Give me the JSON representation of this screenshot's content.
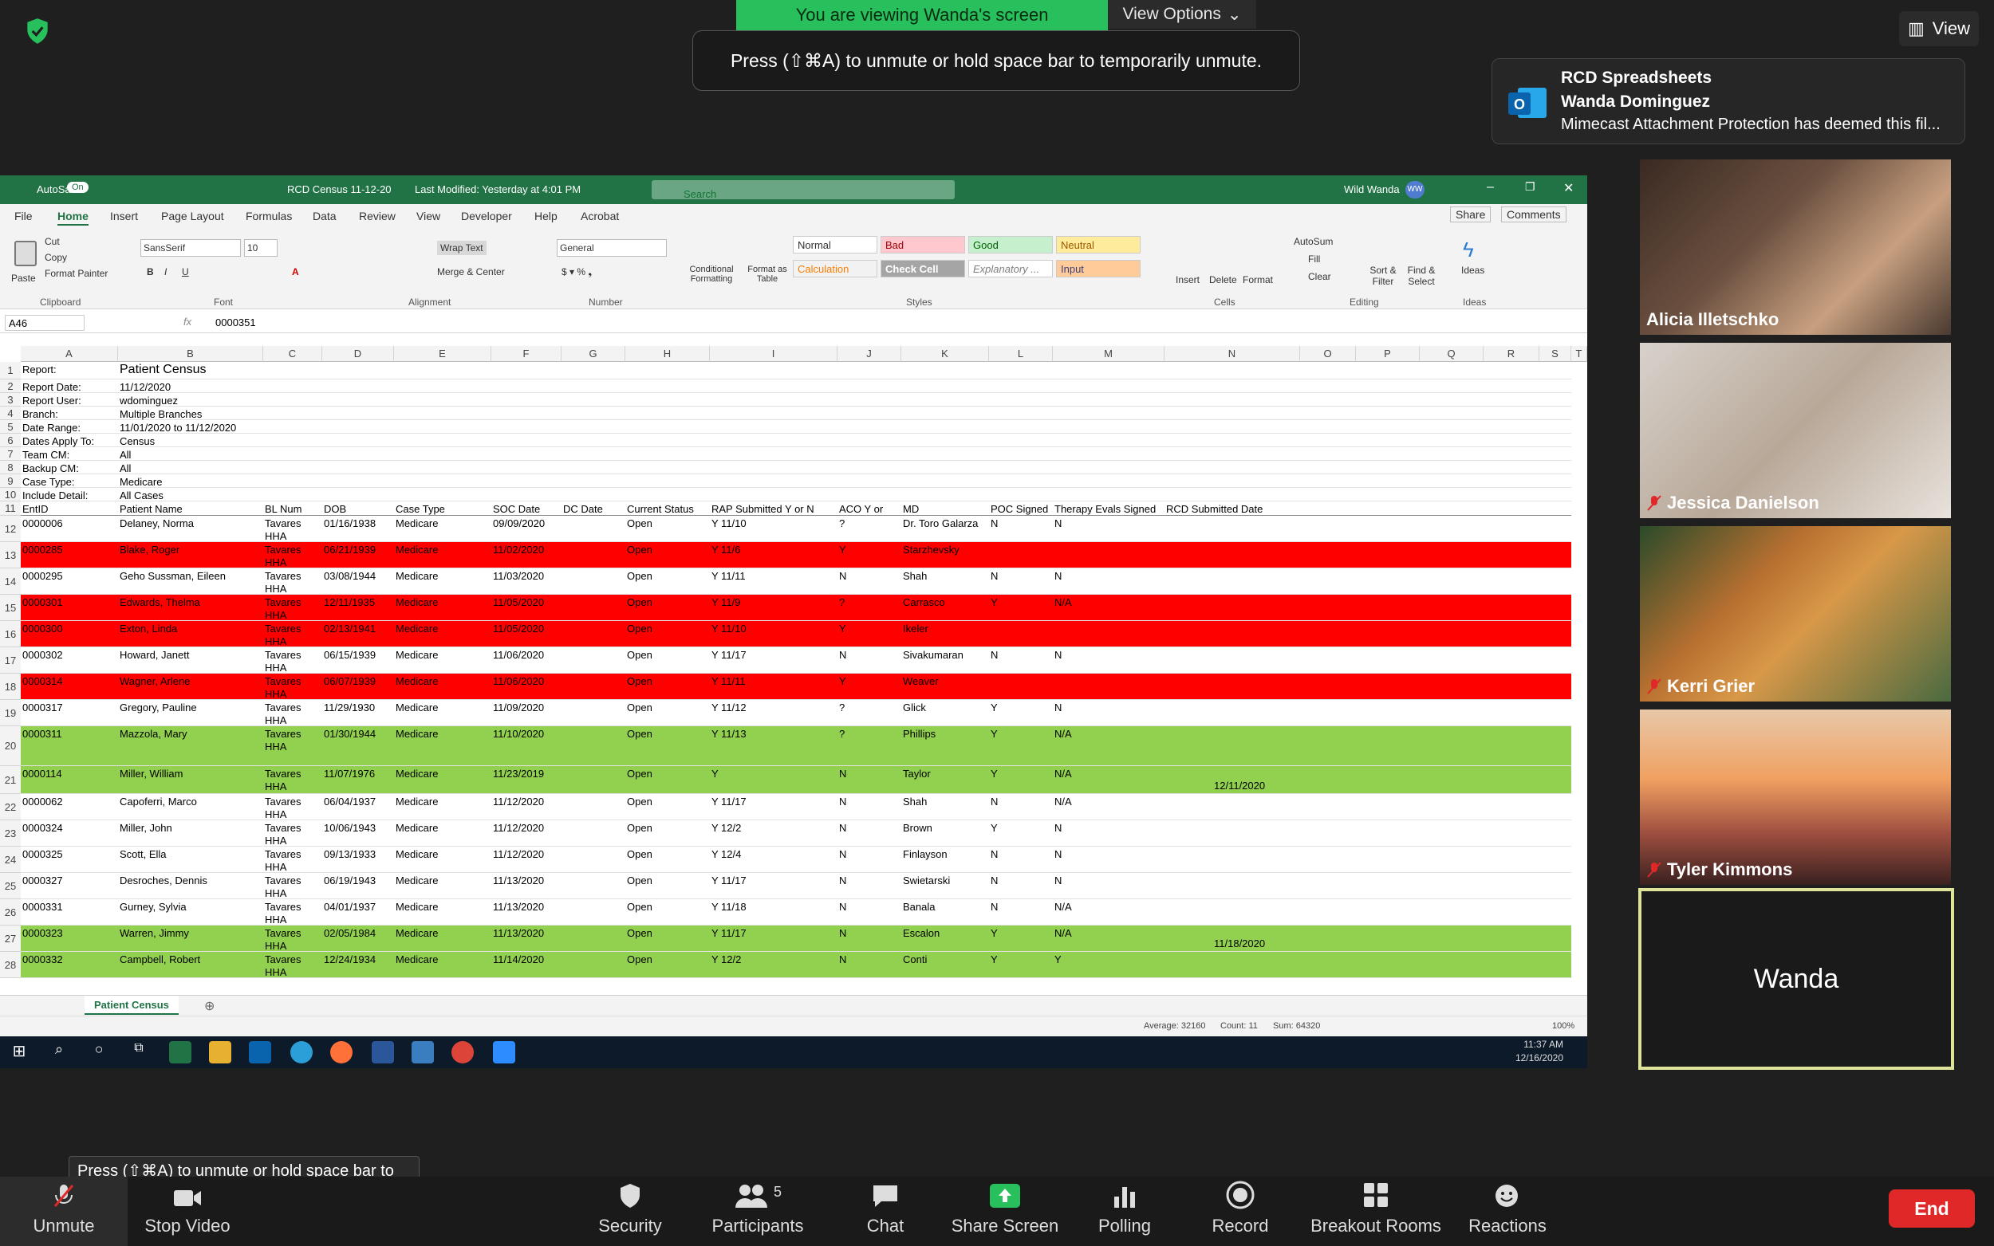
{
  "zoom": {
    "viewing_banner": "You are viewing Wanda's screen",
    "view_options": "View Options",
    "unmute_tip": "Press  (⇧⌘A) to unmute or hold space bar to temporarily unmute.",
    "view_button": "View",
    "tooltip": "Press  (⇧⌘A) to unmute or hold space bar to temporarily unmute.",
    "participant_count": "5",
    "bottom_bar": [
      "Unmute",
      "Stop Video",
      "Security",
      "Participants",
      "Chat",
      "Share Screen",
      "Polling",
      "Record",
      "Breakout Rooms",
      "Reactions"
    ],
    "end_label": "End",
    "share_color": "#27c05c",
    "end_color": "#e02828"
  },
  "notification": {
    "app": "RCD Spreadsheets",
    "sender": "Wanda Dominguez",
    "message": "Mimecast Attachment Protection has deemed this fil..."
  },
  "participants": [
    {
      "name": "Alicia Illetschko",
      "muted": false
    },
    {
      "name": "Jessica Danielson",
      "muted": true
    },
    {
      "name": "Kerri Grier",
      "muted": true
    },
    {
      "name": "Tyler Kimmons",
      "muted": true
    },
    {
      "name": "Wanda",
      "muted": false
    }
  ],
  "excel": {
    "autosave": "AutoSave",
    "autosave_state": "On",
    "file_title": "RCD Census 11-12-20",
    "last_modified": "Last Modified: Yesterday at 4:01 PM",
    "search_placeholder": "Search",
    "user": "Wild Wanda",
    "user_initials": "WW",
    "tabs": [
      "File",
      "Home",
      "Insert",
      "Page Layout",
      "Formulas",
      "Data",
      "Review",
      "View",
      "Developer",
      "Help",
      "Acrobat"
    ],
    "share": "Share",
    "comments": "Comments",
    "ribbon": {
      "paste": "Paste",
      "cut": "Cut",
      "copy": "Copy",
      "format_painter": "Format Painter",
      "clipboard": "Clipboard",
      "font_name": "SansSerif",
      "font_size": "10",
      "font": "Font",
      "wrap_text": "Wrap Text",
      "merge_center": "Merge & Center",
      "alignment": "Alignment",
      "number_format": "General",
      "number": "Number",
      "conditional": "Conditional Formatting",
      "format_table": "Format as Table",
      "styles": "Styles",
      "style_cells": [
        "Normal",
        "Bad",
        "Good",
        "Neutral",
        "Calculation",
        "Check Cell",
        "Explanatory ...",
        "Input"
      ],
      "insert": "Insert",
      "delete": "Delete",
      "format": "Format",
      "cells": "Cells",
      "autosum": "AutoSum",
      "fill": "Fill",
      "clear": "Clear",
      "sort_filter": "Sort & Filter",
      "find_select": "Find & Select",
      "editing": "Editing",
      "ideas": "Ideas",
      "ideas_group": "Ideas"
    },
    "name_box": "A46",
    "formula_value": "0000351",
    "columns": [
      "A",
      "B",
      "C",
      "D",
      "E",
      "F",
      "G",
      "H",
      "I",
      "J",
      "K",
      "L",
      "M",
      "N",
      "O",
      "P",
      "Q",
      "R",
      "S",
      "T"
    ],
    "meta_rows": [
      {
        "n": "1",
        "label": "Report:",
        "value": "Patient Census"
      },
      {
        "n": "2",
        "label": "Report Date:",
        "value": "11/12/2020"
      },
      {
        "n": "3",
        "label": "Report User:",
        "value": "wdominguez"
      },
      {
        "n": "4",
        "label": "Branch:",
        "value": "Multiple Branches"
      },
      {
        "n": "5",
        "label": "Date Range:",
        "value": "11/01/2020 to 11/12/2020"
      },
      {
        "n": "6",
        "label": "Dates Apply To:",
        "value": "Census"
      },
      {
        "n": "7",
        "label": "Team CM:",
        "value": "All"
      },
      {
        "n": "8",
        "label": "Backup CM:",
        "value": "All"
      },
      {
        "n": "9",
        "label": "Case Type:",
        "value": "Medicare"
      },
      {
        "n": "10",
        "label": "Include Detail:",
        "value": "All Cases"
      }
    ],
    "header_row": [
      "EntID",
      "Patient Name",
      "BL Num",
      "DOB",
      "Case Type",
      "SOC Date",
      "DC Date",
      "Current Status",
      "RAP Submitted Y or N",
      "ACO Y or",
      "MD",
      "POC Signed",
      "Therapy Evals Signed",
      "RCD Submitted Date"
    ],
    "data_rows": [
      {
        "n": "12",
        "fill": "",
        "cells": [
          "0000006",
          "Delaney, Norma",
          "Tavares HHA",
          "01/16/1938",
          "Medicare",
          "09/09/2020",
          "",
          "Open",
          "Y 11/10",
          "?",
          "Dr. Toro Galarza",
          "N",
          "N",
          ""
        ]
      },
      {
        "n": "13",
        "fill": "red",
        "cells": [
          "0000285",
          "Blake, Roger",
          "Tavares HHA",
          "06/21/1939",
          "Medicare",
          "11/02/2020",
          "",
          "Open",
          "Y 11/6",
          "Y",
          "Starzhevsky",
          "",
          "",
          ""
        ]
      },
      {
        "n": "14",
        "fill": "",
        "cells": [
          "0000295",
          "Geho Sussman, Eileen",
          "Tavares HHA",
          "03/08/1944",
          "Medicare",
          "11/03/2020",
          "",
          "Open",
          "Y 11/11",
          "N",
          "Shah",
          "N",
          "N",
          ""
        ]
      },
      {
        "n": "15",
        "fill": "red",
        "cells": [
          "0000301",
          "Edwards, Thelma",
          "Tavares HHA",
          "12/11/1935",
          "Medicare",
          "11/05/2020",
          "",
          "Open",
          "Y 11/9",
          "?",
          "Carrasco",
          "Y",
          "N/A",
          ""
        ]
      },
      {
        "n": "16",
        "fill": "red",
        "cells": [
          "0000300",
          "Exton, Linda",
          "Tavares HHA",
          "02/13/1941",
          "Medicare",
          "11/05/2020",
          "",
          "Open",
          "Y 11/10",
          "Y",
          "Ikeler",
          "",
          "",
          ""
        ]
      },
      {
        "n": "17",
        "fill": "",
        "cells": [
          "0000302",
          "Howard, Janett",
          "Tavares HHA",
          "06/15/1939",
          "Medicare",
          "11/06/2020",
          "",
          "Open",
          "Y 11/17",
          "N",
          "Sivakumaran",
          "N",
          "N",
          ""
        ]
      },
      {
        "n": "18",
        "fill": "red",
        "cells": [
          "0000314",
          "Wagner, Arlene",
          "Tavares HHA",
          "06/07/1939",
          "Medicare",
          "11/06/2020",
          "",
          "Open",
          "Y 11/11",
          "Y",
          "Weaver",
          "",
          "",
          ""
        ]
      },
      {
        "n": "19",
        "fill": "",
        "cells": [
          "0000317",
          "Gregory, Pauline",
          "Tavares HHA",
          "11/29/1930",
          "Medicare",
          "11/09/2020",
          "",
          "Open",
          "Y 11/12",
          "?",
          "Glick",
          "Y",
          "N",
          ""
        ]
      },
      {
        "n": "20",
        "fill": "green",
        "cells": [
          "0000311",
          "Mazzola, Mary",
          "Tavares HHA",
          "01/30/1944",
          "Medicare",
          "11/10/2020",
          "",
          "Open",
          "Y 11/13",
          "?",
          "Phillips",
          "Y",
          "N/A",
          ""
        ]
      },
      {
        "n": "21",
        "fill": "green",
        "cells": [
          "0000114",
          "Miller, William",
          "Tavares HHA",
          "11/07/1976",
          "Medicare",
          "11/23/2019",
          "",
          "Open",
          "Y",
          "N",
          "Taylor",
          "Y",
          "N/A",
          "12/11/2020"
        ]
      },
      {
        "n": "22",
        "fill": "",
        "cells": [
          "0000062",
          "Capoferri, Marco",
          "Tavares HHA",
          "06/04/1937",
          "Medicare",
          "11/12/2020",
          "",
          "Open",
          "Y 11/17",
          "N",
          "Shah",
          "N",
          "N/A",
          ""
        ]
      },
      {
        "n": "23",
        "fill": "",
        "cells": [
          "0000324",
          "Miller, John",
          "Tavares HHA",
          "10/06/1943",
          "Medicare",
          "11/12/2020",
          "",
          "Open",
          "Y 12/2",
          "N",
          "Brown",
          "Y",
          "N",
          ""
        ]
      },
      {
        "n": "24",
        "fill": "",
        "cells": [
          "0000325",
          "Scott, Ella",
          "Tavares HHA",
          "09/13/1933",
          "Medicare",
          "11/12/2020",
          "",
          "Open",
          "Y 12/4",
          "N",
          "Finlayson",
          "N",
          "N",
          ""
        ]
      },
      {
        "n": "25",
        "fill": "",
        "cells": [
          "0000327",
          "Desroches, Dennis",
          "Tavares HHA",
          "06/19/1943",
          "Medicare",
          "11/13/2020",
          "",
          "Open",
          "Y 11/17",
          "N",
          "Swietarski",
          "N",
          "N",
          ""
        ]
      },
      {
        "n": "26",
        "fill": "",
        "cells": [
          "0000331",
          "Gurney, Sylvia",
          "Tavares HHA",
          "04/01/1937",
          "Medicare",
          "11/13/2020",
          "",
          "Open",
          "Y 11/18",
          "N",
          "Banala",
          "N",
          "N/A",
          ""
        ]
      },
      {
        "n": "27",
        "fill": "green",
        "cells": [
          "0000323",
          "Warren, Jimmy",
          "Tavares HHA",
          "02/05/1984",
          "Medicare",
          "11/13/2020",
          "",
          "Open",
          "Y 11/17",
          "N",
          "Escalon",
          "Y",
          "N/A",
          "11/18/2020"
        ]
      },
      {
        "n": "28",
        "fill": "green",
        "cells": [
          "0000332",
          "Campbell, Robert",
          "Tavares HHA",
          "12/24/1934",
          "Medicare",
          "11/14/2020",
          "",
          "Open",
          "Y 12/2",
          "N",
          "Conti",
          "Y",
          "Y",
          ""
        ]
      }
    ],
    "sheet_tab": "Patient Census",
    "status": {
      "average": "Average: 32160",
      "count": "Count: 11",
      "sum": "Sum: 64320",
      "zoom": "100%"
    },
    "colors": {
      "red": "#fe0000",
      "green": "#92d050",
      "excel_green": "#217346"
    }
  },
  "taskbar": {
    "time": "11:37 AM",
    "date": "12/16/2020"
  }
}
